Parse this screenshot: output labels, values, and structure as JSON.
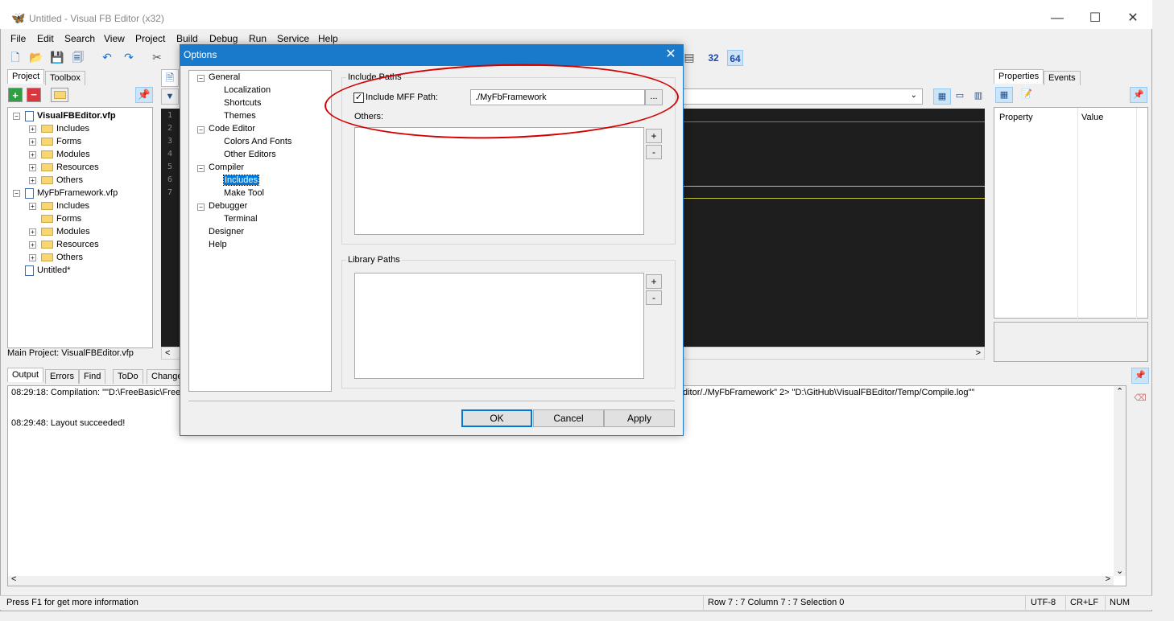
{
  "window": {
    "title": "Untitled - Visual FB Editor (x32)",
    "controls": {
      "minimize": "—",
      "maximize": "☐",
      "close": "✕"
    }
  },
  "menu": [
    "File",
    "Edit",
    "Search",
    "View",
    "Project",
    "Build",
    "Debug",
    "Run",
    "Service",
    "Help"
  ],
  "toolbar": {
    "bits32": "32",
    "bits64": "64"
  },
  "left_panel": {
    "tabs": [
      "Project",
      "Toolbox"
    ],
    "tree": [
      {
        "label": "VisualFBEditor.vfp",
        "bold": true,
        "level": 0,
        "type": "project"
      },
      {
        "label": "Includes",
        "level": 1,
        "type": "folder",
        "exp": true
      },
      {
        "label": "Forms",
        "level": 1,
        "type": "folder",
        "exp": true
      },
      {
        "label": "Modules",
        "level": 1,
        "type": "folder",
        "exp": true
      },
      {
        "label": "Resources",
        "level": 1,
        "type": "folder",
        "exp": true
      },
      {
        "label": "Others",
        "level": 1,
        "type": "folder",
        "exp": true
      },
      {
        "label": "MyFbFramework.vfp",
        "bold": false,
        "level": 0,
        "type": "project"
      },
      {
        "label": "Includes",
        "level": 1,
        "type": "folder",
        "exp": true
      },
      {
        "label": "Forms",
        "level": 1,
        "type": "folder",
        "exp": false
      },
      {
        "label": "Modules",
        "level": 1,
        "type": "folder",
        "exp": true
      },
      {
        "label": "Resources",
        "level": 1,
        "type": "folder",
        "exp": true
      },
      {
        "label": "Others",
        "level": 1,
        "type": "folder",
        "exp": true
      },
      {
        "label": "Untitled*",
        "level": 0,
        "type": "file"
      }
    ],
    "main_project": "Main Project: VisualFBEditor.vfp"
  },
  "editor": {
    "line_numbers": [
      "1",
      "2",
      "3",
      "4",
      "5",
      "6",
      "7"
    ]
  },
  "right_panel": {
    "tabs": [
      "Properties",
      "Events"
    ],
    "headers": [
      "Property",
      "Value"
    ]
  },
  "bottom": {
    "tabs": [
      "Output",
      "Errors",
      "Find",
      "ToDo",
      "Change"
    ],
    "lines": [
      "08:29:18: Compilation: \"\"D:\\FreeBasic\\Free",
      "ditor/./MyFbFramework\" 2> \"D:\\GitHub\\VisualFBEditor/Temp/Compile.log\"\"",
      "08:29:48: Layout succeeded!"
    ]
  },
  "status": {
    "hint": "Press F1 for get more information",
    "position": "Row 7 : 7  Column 7 : 7  Selection 0",
    "encoding": "UTF-8",
    "eol": "CR+LF",
    "num": "NUM"
  },
  "dialog": {
    "title": "Options",
    "tree": [
      {
        "label": "General",
        "level": 0
      },
      {
        "label": "Localization",
        "level": 1
      },
      {
        "label": "Shortcuts",
        "level": 1
      },
      {
        "label": "Themes",
        "level": 1
      },
      {
        "label": "Code Editor",
        "level": 0
      },
      {
        "label": "Colors And Fonts",
        "level": 1
      },
      {
        "label": "Other Editors",
        "level": 1
      },
      {
        "label": "Compiler",
        "level": 0
      },
      {
        "label": "Includes",
        "level": 1,
        "selected": true
      },
      {
        "label": "Make Tool",
        "level": 1
      },
      {
        "label": "Debugger",
        "level": 0
      },
      {
        "label": "Terminal",
        "level": 1
      },
      {
        "label": "Designer",
        "level": 0
      },
      {
        "label": "Help",
        "level": 0
      }
    ],
    "include_paths_label": "Include Paths",
    "include_mff_label": "Include MFF Path:",
    "include_mff_checked": true,
    "mff_path": "./MyFbFramework",
    "browse": "...",
    "others_label": "Others:",
    "library_paths_label": "Library Paths",
    "add": "+",
    "remove": "-",
    "ok": "OK",
    "cancel": "Cancel",
    "apply": "Apply"
  }
}
